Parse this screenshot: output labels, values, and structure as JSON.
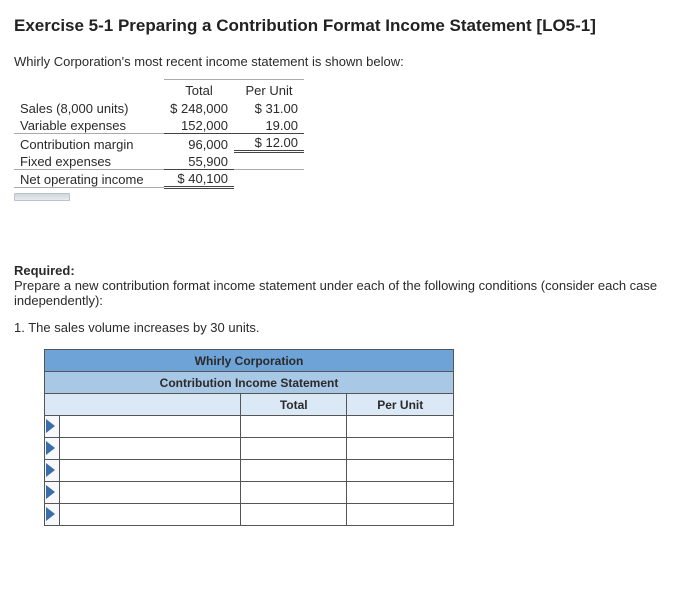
{
  "title": "Exercise 5-1 Preparing a Contribution Format Income Statement [LO5-1]",
  "intro": "Whirly Corporation's most recent income statement is shown below:",
  "given": {
    "hdr_total": "Total",
    "hdr_perunit": "Per Unit",
    "sales_label": "Sales (8,000 units)",
    "sales_total": "$ 248,000",
    "sales_pu": "$ 31.00",
    "var_label": "Variable expenses",
    "var_total": "152,000",
    "var_pu": "19.00",
    "cm_label": "Contribution margin",
    "cm_total": "96,000",
    "cm_pu": "$ 12.00",
    "fixed_label": "Fixed expenses",
    "fixed_total": "55,900",
    "noi_label": "Net operating income",
    "noi_total": "$  40,100"
  },
  "required_hdr": "Required:",
  "required_body": "Prepare a new contribution format income statement under each of the following conditions (consider each case independently):",
  "condition_1": "1. The sales volume increases by 30 units.",
  "answer": {
    "company": "Whirly Corporation",
    "stmt": "Contribution Income Statement",
    "col_total": "Total",
    "col_perunit": "Per Unit"
  }
}
